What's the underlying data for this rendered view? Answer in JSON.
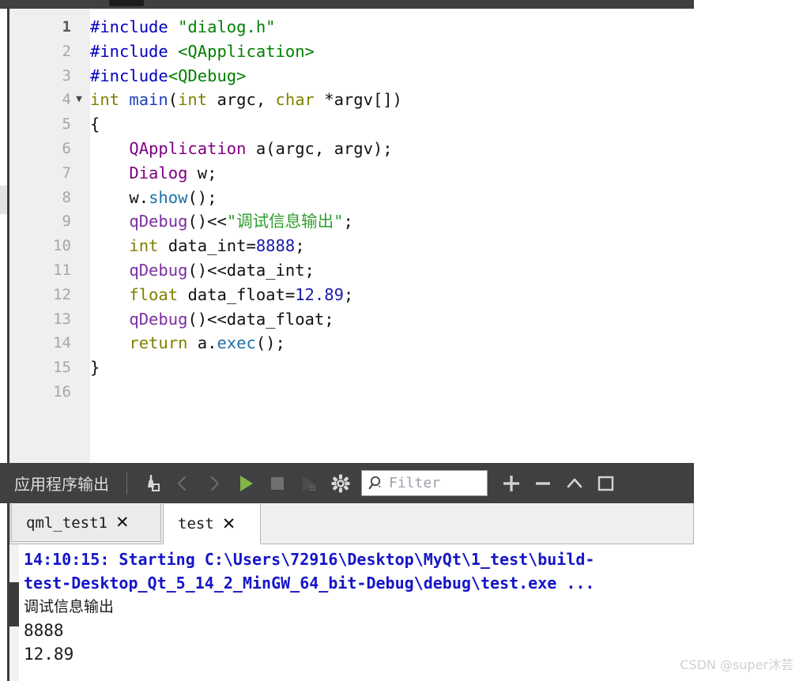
{
  "window": {
    "top_strip_present": true
  },
  "editor": {
    "lines": [
      {
        "num": "1",
        "fold": "",
        "current": true,
        "tokens": [
          {
            "t": "#include ",
            "c": "tok-pre"
          },
          {
            "t": "\"dialog.h\"",
            "c": "tok-inc"
          }
        ]
      },
      {
        "num": "2",
        "fold": "",
        "current": false,
        "tokens": [
          {
            "t": "#include ",
            "c": "tok-pre"
          },
          {
            "t": "<QApplication>",
            "c": "tok-inc"
          }
        ]
      },
      {
        "num": "3",
        "fold": "",
        "current": false,
        "tokens": [
          {
            "t": "#include",
            "c": "tok-pre"
          },
          {
            "t": "<QDebug>",
            "c": "tok-inc"
          }
        ]
      },
      {
        "num": "4",
        "fold": "▼",
        "current": false,
        "tokens": [
          {
            "t": "int ",
            "c": "tok-kw"
          },
          {
            "t": "main",
            "c": "tok-fn"
          },
          {
            "t": "(",
            "c": "tok-punct"
          },
          {
            "t": "int ",
            "c": "tok-kw"
          },
          {
            "t": "argc",
            "c": "tok-plain"
          },
          {
            "t": ", ",
            "c": "tok-punct"
          },
          {
            "t": "char ",
            "c": "tok-kw"
          },
          {
            "t": "*argv[])",
            "c": "tok-plain"
          }
        ]
      },
      {
        "num": "5",
        "fold": "",
        "current": false,
        "tokens": [
          {
            "t": "{",
            "c": "tok-punct"
          }
        ]
      },
      {
        "num": "6",
        "fold": "",
        "current": false,
        "tokens": [
          {
            "t": "    ",
            "c": "tok-plain"
          },
          {
            "t": "QApplication",
            "c": "tok-type"
          },
          {
            "t": " a(argc, argv);",
            "c": "tok-plain"
          }
        ]
      },
      {
        "num": "7",
        "fold": "",
        "current": false,
        "tokens": [
          {
            "t": "    ",
            "c": "tok-plain"
          },
          {
            "t": "Dialog",
            "c": "tok-type"
          },
          {
            "t": " w;",
            "c": "tok-plain"
          }
        ]
      },
      {
        "num": "8",
        "fold": "",
        "current": false,
        "tokens": [
          {
            "t": "    w.",
            "c": "tok-plain"
          },
          {
            "t": "show",
            "c": "tok-mem"
          },
          {
            "t": "();",
            "c": "tok-plain"
          }
        ]
      },
      {
        "num": "9",
        "fold": "",
        "current": false,
        "tokens": [
          {
            "t": "    ",
            "c": "tok-plain"
          },
          {
            "t": "qDebug",
            "c": "tok-call"
          },
          {
            "t": "()<<",
            "c": "tok-plain"
          },
          {
            "t": "\"调试信息输出\"",
            "c": "tok-str"
          },
          {
            "t": ";",
            "c": "tok-plain"
          }
        ]
      },
      {
        "num": "10",
        "fold": "",
        "current": false,
        "tokens": [
          {
            "t": "    ",
            "c": "tok-plain"
          },
          {
            "t": "int ",
            "c": "tok-kw"
          },
          {
            "t": "data_int=",
            "c": "tok-plain"
          },
          {
            "t": "8888",
            "c": "tok-num"
          },
          {
            "t": ";",
            "c": "tok-plain"
          }
        ]
      },
      {
        "num": "11",
        "fold": "",
        "current": false,
        "tokens": [
          {
            "t": "    ",
            "c": "tok-plain"
          },
          {
            "t": "qDebug",
            "c": "tok-call"
          },
          {
            "t": "()<<data_int;",
            "c": "tok-plain"
          }
        ]
      },
      {
        "num": "12",
        "fold": "",
        "current": false,
        "tokens": [
          {
            "t": "    ",
            "c": "tok-plain"
          },
          {
            "t": "float ",
            "c": "tok-kw"
          },
          {
            "t": "data_float=",
            "c": "tok-plain"
          },
          {
            "t": "12.89",
            "c": "tok-num"
          },
          {
            "t": ";",
            "c": "tok-plain"
          }
        ]
      },
      {
        "num": "13",
        "fold": "",
        "current": false,
        "tokens": [
          {
            "t": "    ",
            "c": "tok-plain"
          },
          {
            "t": "qDebug",
            "c": "tok-call"
          },
          {
            "t": "()<<data_float;",
            "c": "tok-plain"
          }
        ]
      },
      {
        "num": "14",
        "fold": "",
        "current": false,
        "tokens": [
          {
            "t": "    ",
            "c": "tok-plain"
          },
          {
            "t": "return ",
            "c": "tok-kw"
          },
          {
            "t": "a.",
            "c": "tok-plain"
          },
          {
            "t": "exec",
            "c": "tok-mem"
          },
          {
            "t": "();",
            "c": "tok-plain"
          }
        ]
      },
      {
        "num": "15",
        "fold": "",
        "current": false,
        "tokens": [
          {
            "t": "}",
            "c": "tok-punct"
          }
        ]
      },
      {
        "num": "16",
        "fold": "",
        "current": false,
        "tokens": []
      }
    ]
  },
  "output_panel": {
    "title": "应用程序输出",
    "toolbar_buttons": [
      {
        "name": "clear-pane-button",
        "icon": "broom-icon",
        "enabled": true
      },
      {
        "name": "previous-item-button",
        "icon": "chevron-left-icon",
        "enabled": false
      },
      {
        "name": "next-item-button",
        "icon": "chevron-right-icon",
        "enabled": false
      },
      {
        "name": "run-button",
        "icon": "play-icon",
        "enabled": true
      },
      {
        "name": "stop-button",
        "icon": "stop-square-icon",
        "enabled": true
      },
      {
        "name": "run-with-debug-button",
        "icon": "play-debug-icon",
        "enabled": false
      },
      {
        "name": "settings-button",
        "icon": "gear-icon",
        "enabled": true
      }
    ],
    "filter": {
      "placeholder": "Filter",
      "value": "",
      "icon": "search-icon"
    },
    "right_buttons": [
      {
        "name": "zoom-in-button",
        "icon": "plus-icon"
      },
      {
        "name": "zoom-out-button",
        "icon": "minus-icon"
      },
      {
        "name": "minimize-pane-button",
        "icon": "chevron-up-icon"
      },
      {
        "name": "maximize-pane-button",
        "icon": "square-outline-icon"
      }
    ],
    "tabs": [
      {
        "label": "qml_test1",
        "close": "✕",
        "active": false
      },
      {
        "label": "test",
        "close": "✕",
        "active": true
      }
    ],
    "lines": [
      {
        "text": "14:10:15: Starting C:\\Users\\72916\\Desktop\\MyQt\\1_test\\build-",
        "style": "stdout-blue"
      },
      {
        "text": "test-Desktop_Qt_5_14_2_MinGW_64_bit-Debug\\debug\\test.exe ...",
        "style": "stdout-blue"
      },
      {
        "text": "调试信息输出",
        "style": "app"
      },
      {
        "text": "8888",
        "style": "app-mono"
      },
      {
        "text": "12.89",
        "style": "app-mono"
      }
    ]
  },
  "watermark": {
    "text": "CSDN @super沐芸"
  },
  "colors": {
    "toolbar_bg": "#3f4042",
    "gutter_bg": "#efefef",
    "editor_bg": "#ffffff",
    "stdout_blue": "#1515c7",
    "string_green": "#2e9e2e",
    "keyword_olive": "#808000",
    "type_purple": "#800080",
    "play_green": "#7cb342"
  }
}
